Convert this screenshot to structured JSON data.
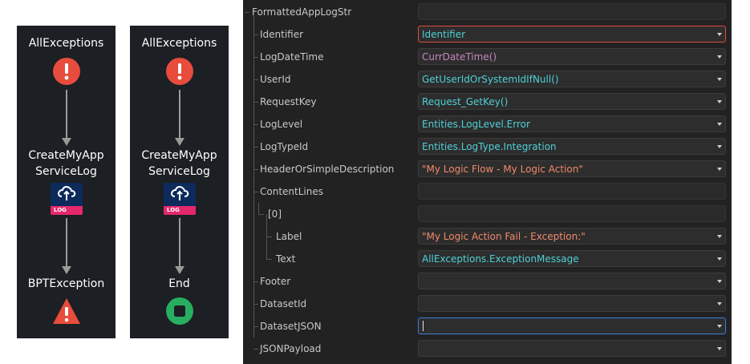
{
  "flows": [
    {
      "start_label": "AllExceptions",
      "start_icon": "exception-handler-icon",
      "action_label_line1": "CreateMyApp",
      "action_label_line2": "ServiceLog",
      "action_icon": "cloud-log-icon",
      "action_icon_text": "LOG",
      "end_label": "BPTException",
      "end_icon": "raise-exception-icon"
    },
    {
      "start_label": "AllExceptions",
      "start_icon": "exception-handler-icon",
      "action_label_line1": "CreateMyApp",
      "action_label_line2": "ServiceLog",
      "action_icon": "cloud-log-icon",
      "action_icon_text": "LOG",
      "end_label": "End",
      "end_icon": "end-node-icon"
    }
  ],
  "properties": [
    {
      "name": "FormattedAppLogStr",
      "value": "",
      "kind": "plain"
    },
    {
      "name": "Identifier",
      "value": "Identifier",
      "color": "cyan",
      "state": "error"
    },
    {
      "name": "LogDateTime",
      "value": "CurrDateTime()",
      "color": "purple"
    },
    {
      "name": "UserId",
      "value": "GetUserIdOrSystemIdIfNull()",
      "color": "cyan"
    },
    {
      "name": "RequestKey",
      "value": "Request_GetKey()",
      "color": "cyan"
    },
    {
      "name": "LogLevel",
      "value": "Entities.LogLevel.Error",
      "color": "cyan"
    },
    {
      "name": "LogTypeId",
      "value": "Entities.LogType.Integration",
      "color": "cyan"
    },
    {
      "name": "HeaderOrSimpleDescription",
      "value": "\"My Logic Flow - My Logic Action\"",
      "color": "orange"
    },
    {
      "name": "ContentLines",
      "value": "",
      "kind": "plain"
    },
    {
      "name": "[0]",
      "value": "",
      "kind": "plain"
    },
    {
      "name": "Label",
      "value": "\"My Logic Action Fail - Exception:\"",
      "color": "orange"
    },
    {
      "name": "Text",
      "value": "AllExceptions.ExceptionMessage",
      "color": "cyan"
    },
    {
      "name": "Footer",
      "value": ""
    },
    {
      "name": "DatasetId",
      "value": ""
    },
    {
      "name": "DatasetJSON",
      "value": "",
      "state": "focus"
    },
    {
      "name": "JSONPayload",
      "value": ""
    }
  ],
  "colors": {
    "exception_red": "#e74c3c",
    "end_green": "#27ae60",
    "log_pink": "#e5286a",
    "log_navy": "#0d2a5c",
    "error_border": "#e04a3f",
    "focus_border": "#3b7ddd"
  }
}
